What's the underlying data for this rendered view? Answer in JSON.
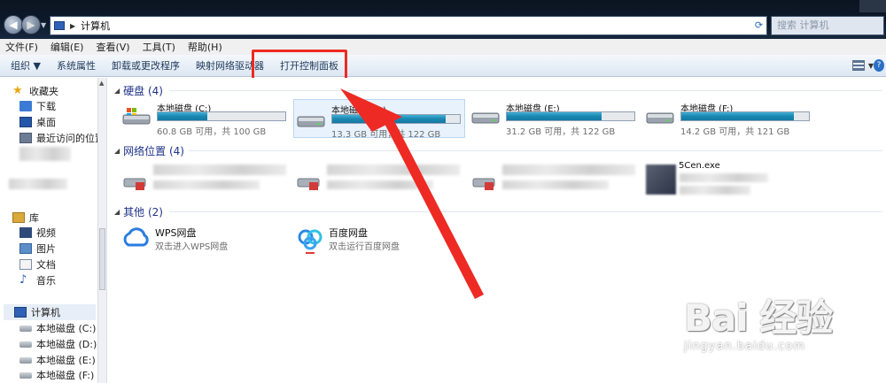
{
  "address": {
    "path": "计算机",
    "search_placeholder": "搜索 计算机"
  },
  "menu": [
    "文件(F)",
    "编辑(E)",
    "查看(V)",
    "工具(T)",
    "帮助(H)"
  ],
  "commands": {
    "organize": "组织 ▼",
    "properties": "系统属性",
    "uninstall": "卸载或更改程序",
    "map_drive": "映射网络驱动器",
    "control_panel": "打开控制面板"
  },
  "sidebar": {
    "favorites": "收藏夹",
    "downloads": "下载",
    "desktop": "桌面",
    "recent": "最近访问的位置",
    "libraries": "库",
    "videos": "视频",
    "pictures": "图片",
    "documents": "文档",
    "music": "音乐",
    "computer": "计算机",
    "drives": [
      "本地磁盘 (C:)",
      "本地磁盘 (D:)",
      "本地磁盘 (E:)",
      "本地磁盘 (F:)"
    ]
  },
  "groups": {
    "hard_disks": "硬盘 (4)",
    "network": "网络位置 (4)",
    "other": "其他 (2)"
  },
  "drives": [
    {
      "name": "本地磁盘 (C:)",
      "free_text": "60.8 GB 可用，共 100 GB",
      "used_fraction": 0.39
    },
    {
      "name": "本地磁盘 (D:)",
      "free_text": "13.3 GB 可用，共 122 GB",
      "used_fraction": 0.89
    },
    {
      "name": "本地磁盘 (E:)",
      "free_text": "31.2 GB 可用，共 122 GB",
      "used_fraction": 0.74
    },
    {
      "name": "本地磁盘 (F:)",
      "free_text": "14.2 GB 可用，共 121 GB",
      "used_fraction": 0.88
    }
  ],
  "network_last_label": "5Cen.exe",
  "other_items": [
    {
      "name": "WPS网盘",
      "sub": "双击进入WPS网盘"
    },
    {
      "name": "百度网盘",
      "sub": "双击运行百度网盘"
    }
  ],
  "watermark": {
    "big": "Bai 经验",
    "small": "jingyan.baidu.com"
  },
  "colors": {
    "accent_red": "#ee2a24",
    "group_blue": "#1e3287",
    "bar_fill": "#1b86b0"
  }
}
